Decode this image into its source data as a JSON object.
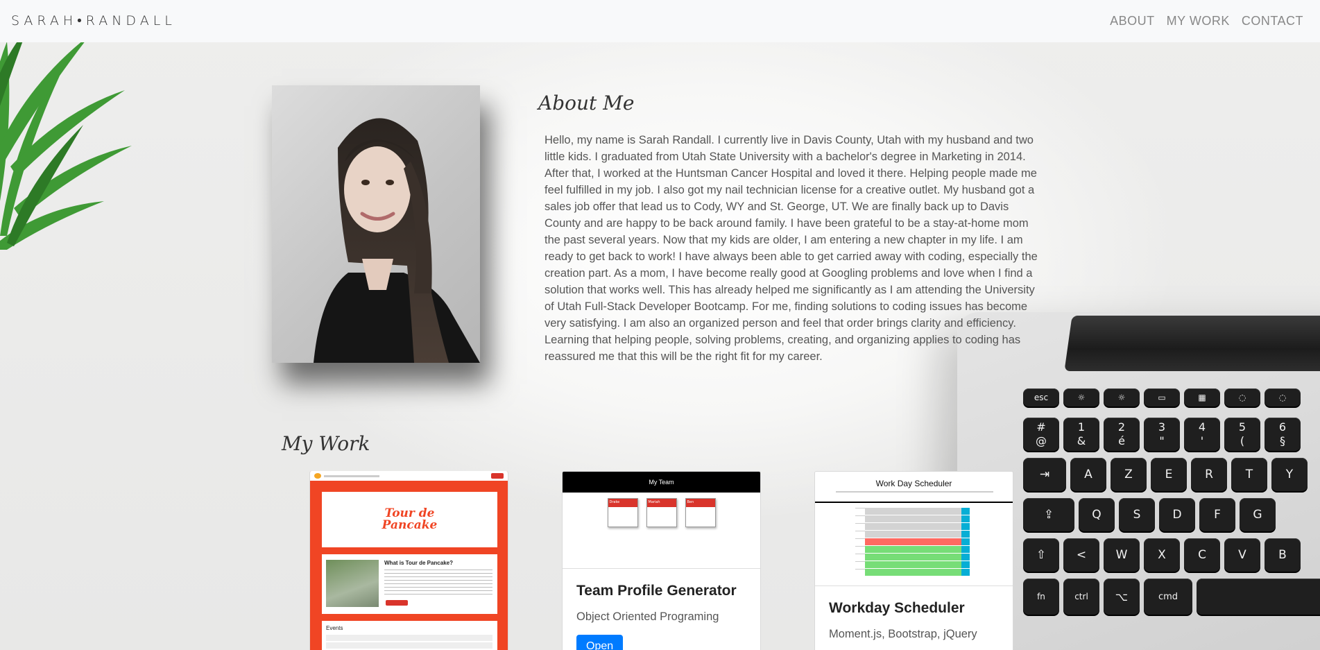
{
  "nav": {
    "brand": "SARAH•RANDALL",
    "links": [
      "ABOUT",
      "MY WORK",
      "CONTACT"
    ]
  },
  "about": {
    "title": "About Me",
    "paragraph": "Hello, my name is Sarah Randall. I currently live in Davis County, Utah with my husband and two little kids. I graduated from Utah State University with a bachelor's degree in Marketing in 2014. After that, I worked at the Huntsman Cancer Hospital and loved it there. Helping people made me feel fulfilled in my job. I also got my nail technician license for a creative outlet. My husband got a sales job offer that lead us to Cody, WY and St. George, UT. We are finally back up to Davis County and are happy to be back around family. I have been grateful to be a stay-at-home mom the past several years. Now that my kids are older, I am entering a new chapter in my life. I am ready to get back to work! I have always been able to get carried away with coding, especially the creation part. As a mom, I have become really good at Googling problems and love when I find a solution that works well. This has already helped me significantly as I am attending the University of Utah Full-Stack Developer Bootcamp. For me, finding solutions to coding issues has become very satisfying. I am also an organized person and feel that order brings clarity and efficiency. Learning that helping people, solving problems, creating, and organizing applies to coding has reassured me that this will be the right fit for my career."
  },
  "work": {
    "title": "My Work",
    "projects": [
      {
        "preview": {
          "logo": "Tour de Pancake",
          "heading": "What is Tour de Pancake?",
          "events_label": "Events"
        }
      },
      {
        "name": "Team Profile Generator",
        "tech": "Object Oriented Programing",
        "button": "Open",
        "preview": {
          "header": "My Team",
          "members": [
            "Drake",
            "Mariah",
            "Ben"
          ]
        }
      },
      {
        "name": "Workday Scheduler",
        "tech": "Moment.js, Bootstrap, jQuery",
        "preview": {
          "header": "Work Day Scheduler"
        }
      }
    ]
  },
  "keyboard": {
    "row1": [
      "esc",
      "☼",
      "☼",
      "▭",
      "▦",
      "◌",
      "◌"
    ],
    "row2": [
      "@",
      "&",
      "é",
      "\"",
      "'",
      "(",
      "§"
    ],
    "row2top": [
      "#",
      "1",
      "2",
      "3",
      "4",
      "5",
      "6"
    ],
    "row3": [
      "⇥",
      "A",
      "Z",
      "E",
      "R",
      "T",
      "Y"
    ],
    "row4": [
      "⇪",
      "Q",
      "S",
      "D",
      "F",
      "G"
    ],
    "row5": [
      "⇧",
      "<",
      "W",
      "X",
      "C",
      "V",
      "B"
    ],
    "row6": [
      "fn",
      "ctrl",
      "⌥",
      "cmd"
    ]
  },
  "colors": {
    "nav_bg": "#f8f9fa",
    "accent_red": "#f04524",
    "button_blue": "#007bff",
    "scheduler_red": "#ff6961",
    "scheduler_green": "#77dd77"
  }
}
